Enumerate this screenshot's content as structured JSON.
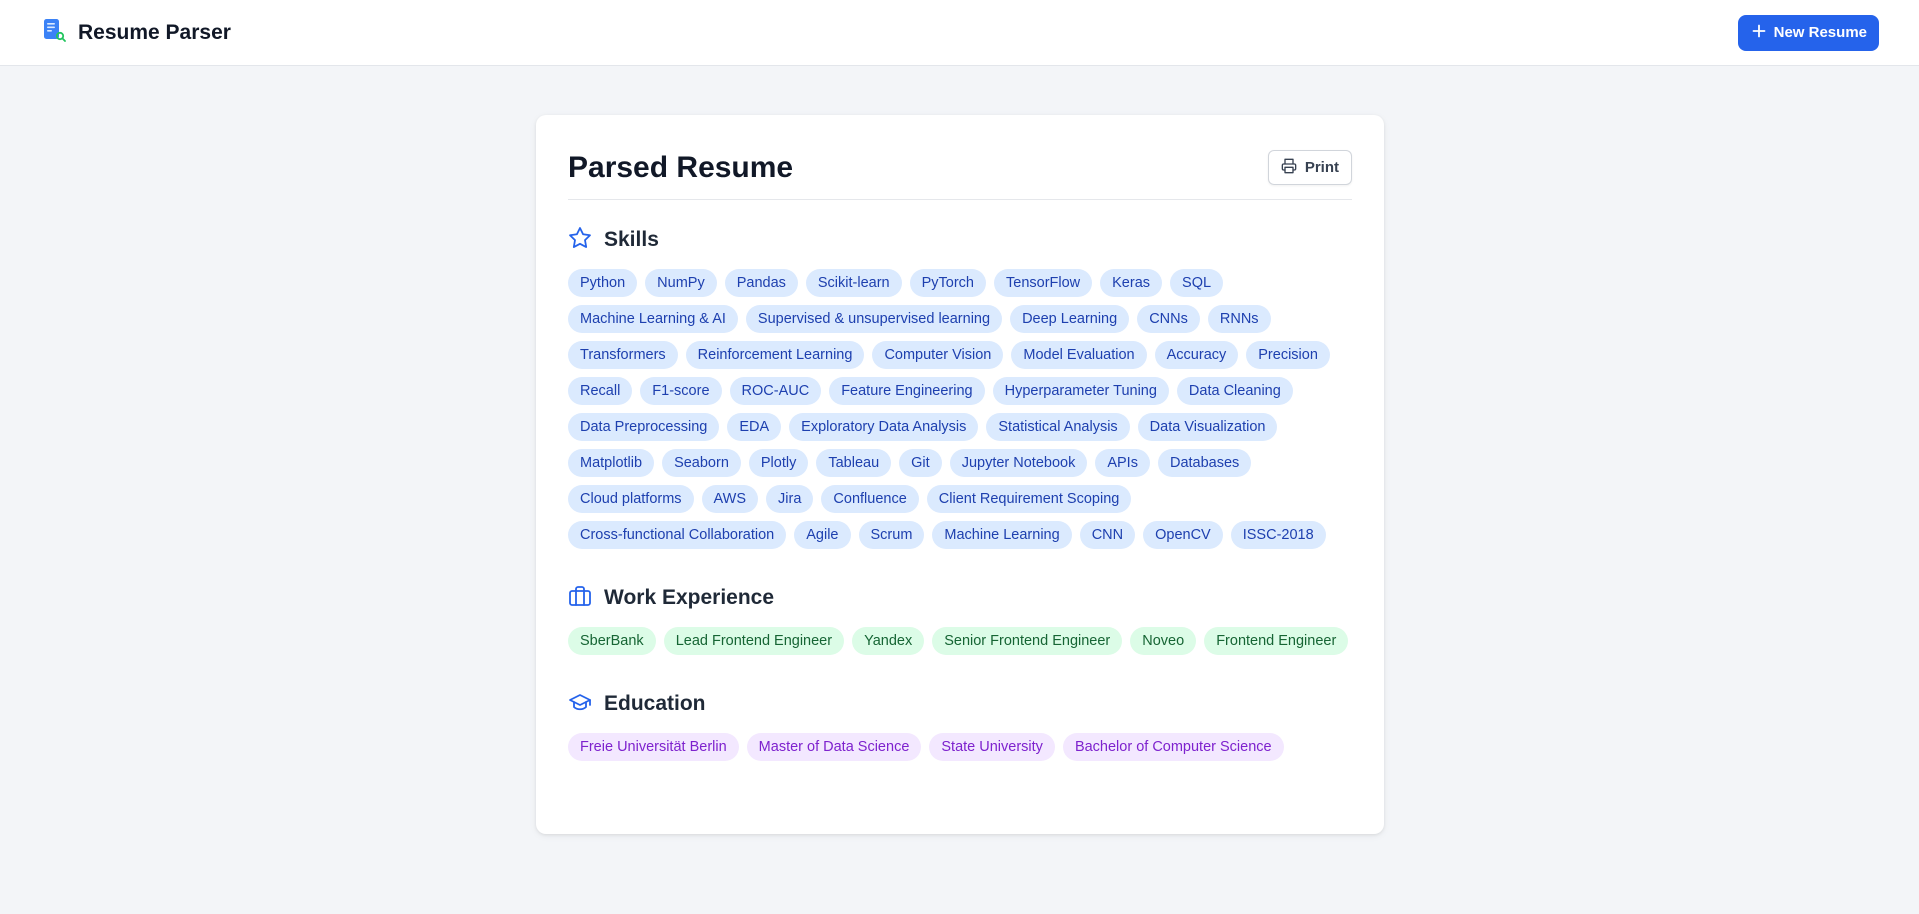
{
  "header": {
    "title": "Resume Parser",
    "new_resume_label": "New Resume"
  },
  "card": {
    "title": "Parsed Resume",
    "print_label": "Print"
  },
  "sections": {
    "skills": {
      "title": "Skills",
      "items": [
        "Python",
        "NumPy",
        "Pandas",
        "Scikit-learn",
        "PyTorch",
        "TensorFlow",
        "Keras",
        "SQL",
        "Machine Learning & AI",
        "Supervised & unsupervised learning",
        "Deep Learning",
        "CNNs",
        "RNNs",
        "Transformers",
        "Reinforcement Learning",
        "Computer Vision",
        "Model Evaluation",
        "Accuracy",
        "Precision",
        "Recall",
        "F1-score",
        "ROC-AUC",
        "Feature Engineering",
        "Hyperparameter Tuning",
        "Data Cleaning",
        "Data Preprocessing",
        "EDA",
        "Exploratory Data Analysis",
        "Statistical Analysis",
        "Data Visualization",
        "Matplotlib",
        "Seaborn",
        "Plotly",
        "Tableau",
        "Git",
        "Jupyter Notebook",
        "APIs",
        "Databases",
        "Cloud platforms",
        "AWS",
        "Jira",
        "Confluence",
        "Client Requirement Scoping",
        "Cross-functional Collaboration",
        "Agile",
        "Scrum",
        "Machine Learning",
        "CNN",
        "OpenCV",
        "ISSC-2018"
      ]
    },
    "work": {
      "title": "Work Experience",
      "items": [
        "SberBank",
        "Lead Frontend Engineer",
        "Yandex",
        "Senior Frontend Engineer",
        "Noveo",
        "Frontend Engineer"
      ]
    },
    "education": {
      "title": "Education",
      "items": [
        "Freie Universität Berlin",
        "Master of Data Science",
        "State University",
        "Bachelor of Computer Science"
      ]
    }
  },
  "colors": {
    "accent": "#2563eb",
    "skill_tag_bg": "#dbeafe",
    "skill_tag_text": "#1e40af",
    "work_tag_bg": "#dcfce7",
    "work_tag_text": "#166534",
    "edu_tag_bg": "#f3e8ff",
    "edu_tag_text": "#7e22ce"
  },
  "icons": {
    "logo": "document-search-icon",
    "new_resume": "plus-icon",
    "print": "printer-icon",
    "skills": "star-icon",
    "work": "briefcase-icon",
    "education": "graduation-cap-icon"
  }
}
